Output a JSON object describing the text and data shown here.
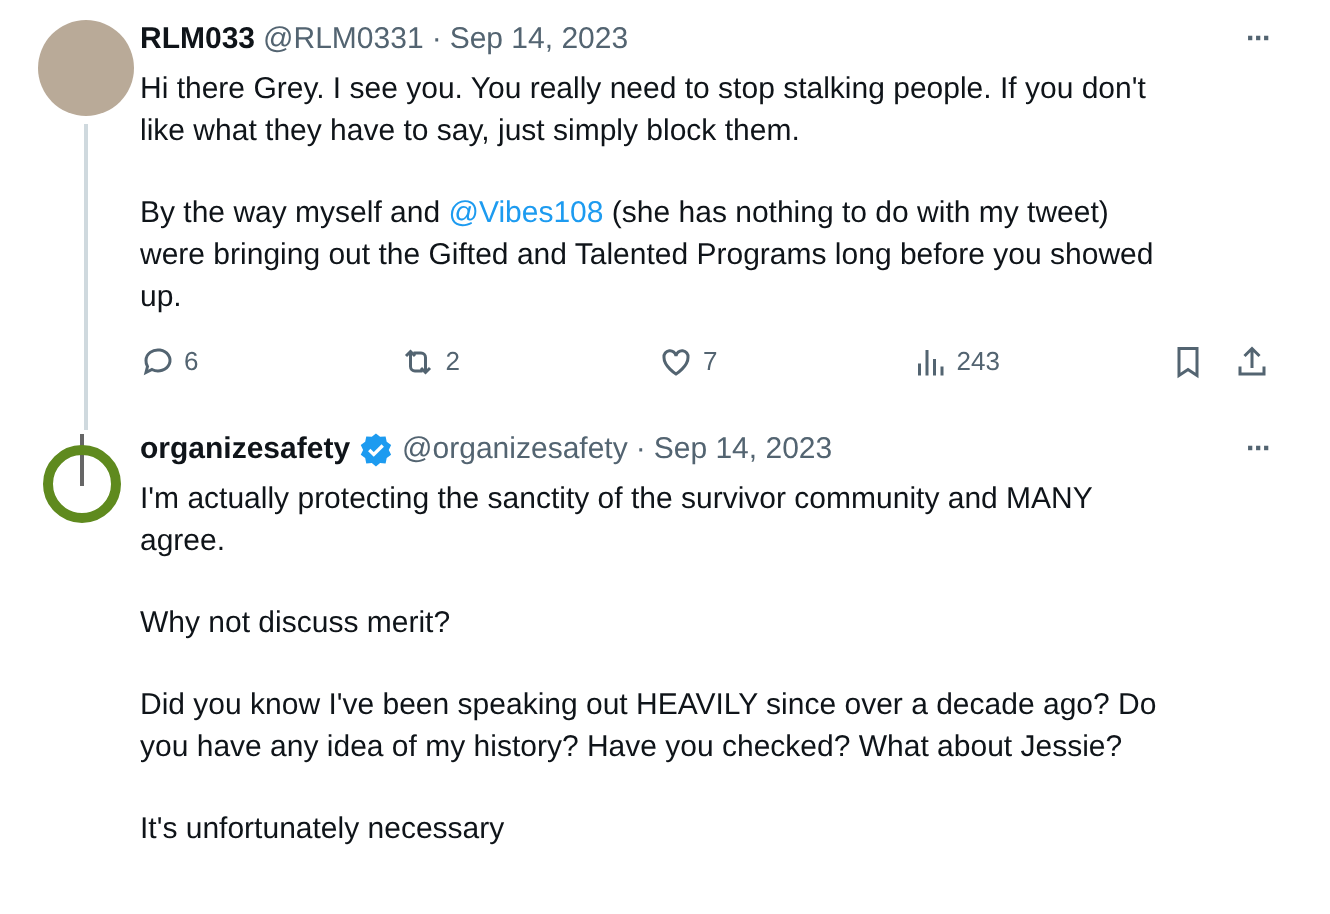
{
  "tweets": [
    {
      "author": {
        "name": "RLM033",
        "handle": "@RLM0331",
        "verified": false,
        "avatar": {
          "kind": "photo"
        }
      },
      "separator": "·",
      "date": "Sep 14, 2023",
      "more": "···",
      "paragraphs": [
        [
          {
            "kind": "plain",
            "text": "Hi there Grey. I see you. You really need to stop stalking people. If you don't like what they have to say, just simply block them."
          }
        ],
        [
          {
            "kind": "plain",
            "text": "By the way myself and "
          },
          {
            "kind": "mention",
            "text": "@Vibes108"
          },
          {
            "kind": "plain",
            "text": " (she has nothing to do with my tweet) were bringing out the Gifted and Talented Programs long before you showed up."
          }
        ]
      ],
      "actions": {
        "replies": "6",
        "reposts": "2",
        "likes": "7",
        "views": "243"
      }
    },
    {
      "author": {
        "name": "organizesafety",
        "handle": "@organizesafety",
        "verified": true,
        "avatar": {
          "kind": "ring"
        }
      },
      "separator": "·",
      "date": "Sep 14, 2023",
      "more": "···",
      "paragraphs": [
        [
          {
            "kind": "plain",
            "text": "I'm actually protecting the sanctity of the survivor community and MANY agree."
          }
        ],
        [
          {
            "kind": "plain",
            "text": "Why not discuss merit?"
          }
        ],
        [
          {
            "kind": "plain",
            "text": "Did you know I've been speaking out HEAVILY since over a decade ago? Do you have any idea of my history? Have you checked? What about Jessie?"
          }
        ],
        [
          {
            "kind": "plain",
            "text": "It's unfortunately necessary"
          }
        ]
      ]
    }
  ]
}
